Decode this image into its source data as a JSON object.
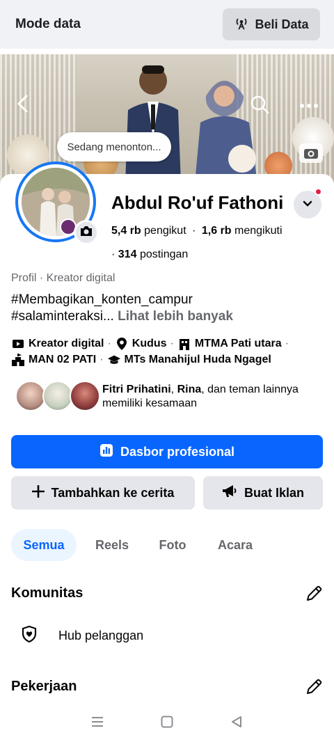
{
  "databar": {
    "title": "Mode data",
    "buy_label": "Beli Data"
  },
  "cover": {
    "watching": "Sedang menonton..."
  },
  "profile": {
    "name": "Abdul Ro'uf Fathoni",
    "followers_count": "5,4 rb",
    "followers_label": "pengikut",
    "following_count": "1,6 rb",
    "following_label": "mengikuti",
    "posts_count": "314",
    "posts_label": "postingan",
    "category": "Profil · Kreator digital",
    "bio_line1": "#Membagikan_konten_campur",
    "bio_line2": "#salaminteraksi...",
    "see_more": "Lihat lebih banyak"
  },
  "details": {
    "row1": [
      {
        "icon": "creator-icon",
        "text": "Kreator digital"
      },
      {
        "icon": "location-icon",
        "text": "Kudus"
      },
      {
        "icon": "school-icon",
        "text": "MTMA Pati utara"
      }
    ],
    "row2": [
      {
        "icon": "school-building-icon",
        "text": "MAN 02 PATI"
      },
      {
        "icon": "graduation-cap-icon",
        "text": "MTs Manahijul Huda Ngagel"
      }
    ]
  },
  "mutual": {
    "name1": "Fitri Prihatini",
    "name2": "Rina",
    "suffix1": ", dan teman lainnya",
    "line2": "memiliki kesamaan"
  },
  "actions": {
    "dashboard": "Dasbor profesional",
    "add_story": "Tambahkan ke cerita",
    "ads": "Buat Iklan"
  },
  "tabs": [
    "Semua",
    "Reels",
    "Foto",
    "Acara"
  ],
  "sections": {
    "community_title": "Komunitas",
    "hub_label": "Hub pelanggan",
    "work_title": "Pekerjaan"
  },
  "colors": {
    "accent": "#0866ff",
    "ring": "#1877f2",
    "secondary_bg": "#e4e6eb",
    "muted_text": "#65676b"
  }
}
